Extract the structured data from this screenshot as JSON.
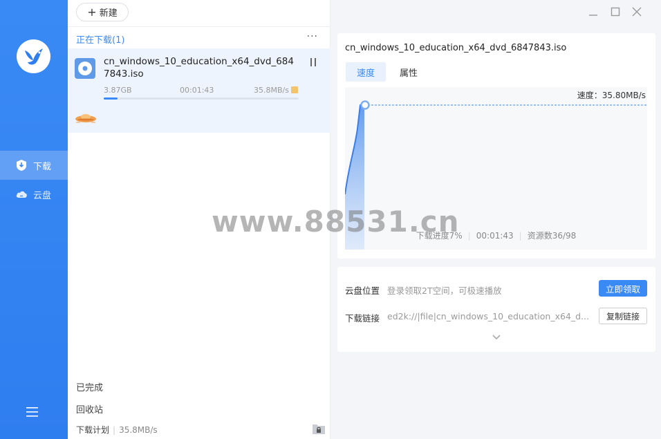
{
  "sidebar": {
    "items": [
      {
        "label": "下载",
        "icon": "download-shield-icon",
        "active": true
      },
      {
        "label": "云盘",
        "icon": "cloud-icon",
        "active": false
      }
    ]
  },
  "list": {
    "new_button": "新建",
    "section_title": "正在下载(1)",
    "more": "···",
    "task": {
      "name": "cn_windows_10_education_x64_dvd_6847843.iso",
      "size": "3.87GB",
      "elapsed": "00:01:43",
      "speed": "35.8MB/s",
      "progress_fraction": 0.07
    },
    "completed": "已完成",
    "recycle": "回收站",
    "plan_label": "下载计划",
    "plan_speed": "35.8MB/s"
  },
  "detail": {
    "file_title": "cn_windows_10_education_x64_dvd_6847843.iso",
    "tabs": [
      {
        "label": "速度",
        "active": true
      },
      {
        "label": "属性",
        "active": false
      }
    ],
    "speed_readout": "速度：35.80MB/s",
    "progress_text": "下载进度7%",
    "elapsed": "00:01:43",
    "resources": "资源数36/98"
  },
  "cloud": {
    "location_label": "云盘位置",
    "location_value": "登录领取2T空间，可极速播放",
    "claim_button": "立即领取",
    "link_label": "下载链接",
    "link_value": "ed2k://|file|cn_windows_10_education_x64_d...",
    "copy_button": "复制链接"
  },
  "watermark": "www.88531.cn",
  "colors": {
    "accent": "#3a8af5",
    "sidebar": "#2f7ef0"
  }
}
